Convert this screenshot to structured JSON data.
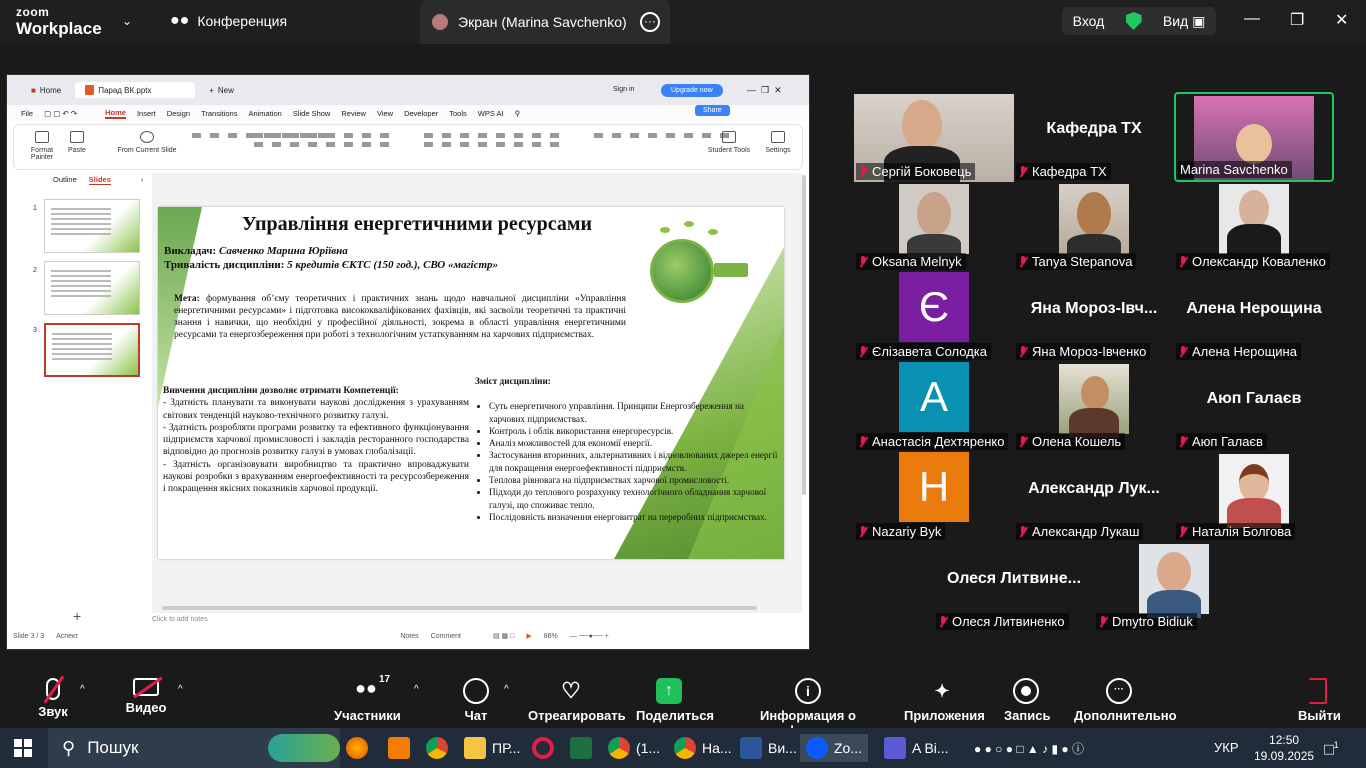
{
  "topbar": {
    "brand_line1": "zoom",
    "brand_line2": "Workplace",
    "conference_label": "Конференция",
    "screen_tab_label": "Экран (Marina Savchenko)",
    "signin_label": "Вход",
    "view_label": "Вид",
    "accent_green": "#22c55e"
  },
  "pres": {
    "tab_home": "Home",
    "tab_file": "Парад ВК.pptx",
    "tab_new": "New",
    "signin": "Sign in",
    "upgrade": "Upgrade now",
    "share": "Share",
    "menu": [
      "File",
      "Home",
      "Insert",
      "Design",
      "Transitions",
      "Animation",
      "Slide Show",
      "Review",
      "View",
      "Developer",
      "Tools",
      "WPS AI"
    ],
    "ribbon": {
      "format_painter": "Format Painter",
      "paste": "Paste",
      "from_current": "From Current Slide",
      "student_tools": "Student Tools",
      "settings": "Settings"
    },
    "pane_outline": "Outline",
    "pane_slides": "Slides",
    "thumbs": [
      "1",
      "2",
      "3"
    ],
    "notes_placeholder": "Click to add notes",
    "status_slide": "Slide 3 / 3",
    "status_aspect": "Аспект",
    "status_notes": "Notes",
    "status_comment": "Comment",
    "status_zoom": "86%"
  },
  "slide": {
    "title": "Управління енергетичними ресурсами",
    "teacher_label": "Викладач:",
    "teacher_name": "Савченко Марина Юріївна",
    "duration_label": "Тривалість дисципліни:",
    "duration_value": "5 кредитів ЄКТС (150 год.), СВО «магістр»",
    "goal_label": "Мета:",
    "goal_text": "формування об’єму теоретичних і практичних знань щодо навчальної дисципліни «Управління енергетичними ресурсами» і підготовка висококваліфікованих фахівців, які засвоїли теоретичні та практичні знання і навички, що необхідні у професійної діяльності, зокрема в області управління енергетичними ресурсами та енергозбереження при роботі з технологічним устаткуванням на харчових підприємствах.",
    "competences_title": "Вивчення дисципліни дозволяє отримати Компетенції:",
    "competences": [
      "- Здатність планувати та виконувати наукові дослідження з урахуванням світових тенденцій науково-технічного розвитку галузі.",
      "- Здатність розробляти програми розвитку та ефективного функціонування підприємств харчової промисловості і закладів ресторанного господарства відповідно до прогнозів розвитку галузі в умовах глобалізації.",
      "- Здатність організовувати виробництво та практично впроваджувати наукові розробки з врахуванням енергоефективності та ресурсозбереження і покращення якісних показників харчової продукції."
    ],
    "content_title": "Зміст дисципліни:",
    "content_items": [
      "Суть енергетичного управління. Принципи Енергозбереження на харчових підприємствах.",
      "Контроль і облік використання енергоресурсів.",
      "Аналіз можливостей для економії енергії.",
      "Застосування вторинних, альтернативних і відновлюваних джерел енергії для покращення енергоефективності підприємств.",
      "Теплова рівновага на підприємствах харчової промисловості.",
      "Підходи до теплового розрахунку технологічного обладнання харчової галузі, що споживає тепло.",
      "Послідовність визначення енерговитрат на переробних підприємствах."
    ]
  },
  "participants": [
    {
      "name": "Сергій Боковець",
      "type": "video"
    },
    {
      "name": "Кафедра ТХ",
      "type": "name",
      "big": "Кафедра ТХ"
    },
    {
      "name": "Marina Savchenko",
      "type": "video",
      "speaking": true
    },
    {
      "name": "Oksana Melnyk",
      "type": "video"
    },
    {
      "name": "Tanya Stepanova",
      "type": "video"
    },
    {
      "name": "Олександр Коваленко",
      "type": "video"
    },
    {
      "name": "Єлізавета Солодка",
      "type": "letter",
      "letter": "Є",
      "color": "#7b1fa2"
    },
    {
      "name": "Яна Мороз-Івченко",
      "type": "name",
      "big": "Яна  Мороз-Івч..."
    },
    {
      "name": "Алена Нерощина",
      "type": "name",
      "big": "Алена Нерощина"
    },
    {
      "name": "Анастасія Дехтяренко",
      "type": "letter",
      "letter": "A",
      "color": "#0891b2"
    },
    {
      "name": "Олена Кошель",
      "type": "video"
    },
    {
      "name": "Аюп Галаєв",
      "type": "name",
      "big": "Аюп Галаєв"
    },
    {
      "name": "Nazariy Byk",
      "type": "letter",
      "letter": "H",
      "color": "#ea7b0c"
    },
    {
      "name": "Александр Лукаш",
      "type": "name",
      "big": "Александр  Лук..."
    },
    {
      "name": "Наталія Болгова",
      "type": "video"
    },
    {
      "name": "Олеся Литвиненко",
      "type": "name",
      "big": "Олеся  Литвине..."
    },
    {
      "name": "Dmytro Bidiuk",
      "type": "video"
    }
  ],
  "toolbar": {
    "sound": "Звук",
    "video": "Видео",
    "participants": "Участники",
    "participants_count": "17",
    "chat": "Чат",
    "react": "Отреагировать",
    "share": "Поделиться",
    "info": "Информация о конференции",
    "apps": "Приложения",
    "record": "Запись",
    "more": "Дополнительно",
    "leave": "Выйти"
  },
  "taskbar": {
    "search": "Пошук",
    "pr_label": "ПР...",
    "chrome1": "(1...",
    "ha_label": "На...",
    "word_label": "Ви...",
    "zoom_label": "Zo...",
    "ai_label": "A Bi...",
    "lang": "УКР",
    "time": "12:50",
    "date": "19.09.2025",
    "notif": "1"
  }
}
